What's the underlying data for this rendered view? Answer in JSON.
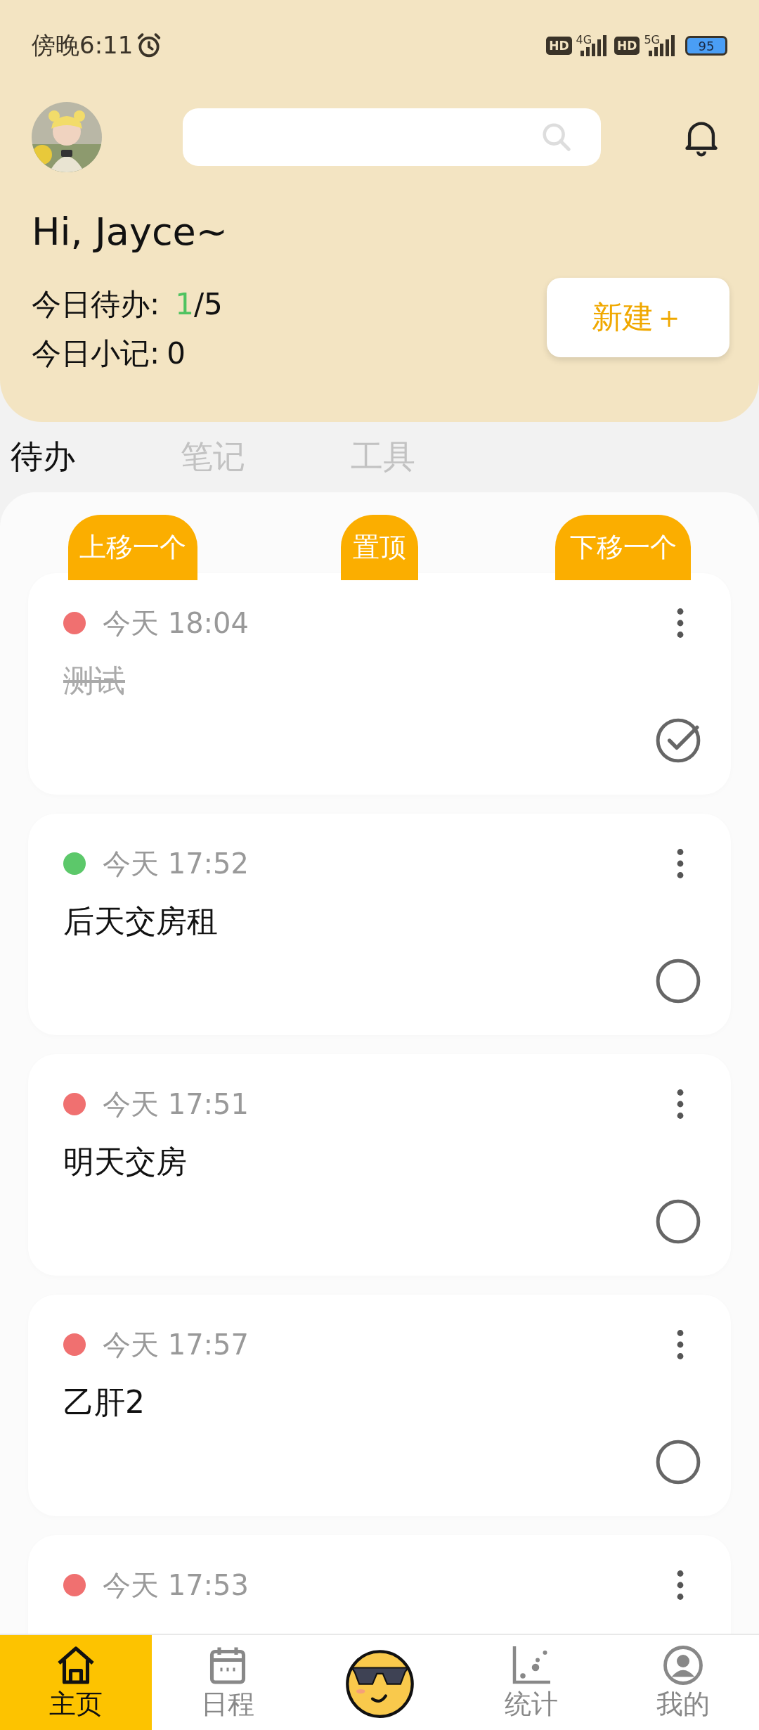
{
  "status_bar": {
    "time": "傍晚6:11",
    "networks": [
      {
        "badge": "HD",
        "type": "4G"
      },
      {
        "badge": "HD",
        "type": "5G"
      }
    ],
    "battery": "95"
  },
  "header": {
    "greeting": "Hi, Jayce~",
    "stats": [
      {
        "label": "今日待办:",
        "done": "1",
        "total": "/5"
      },
      {
        "label": "今日小记:",
        "value": "0"
      }
    ],
    "new_button": "新建＋"
  },
  "tabs": [
    {
      "label": "待办",
      "selected": true
    },
    {
      "label": "笔记",
      "selected": false
    },
    {
      "label": "工具",
      "selected": false
    }
  ],
  "actions": [
    "上移一个",
    "置顶",
    "下移一个"
  ],
  "todos": [
    {
      "color": "#f07070",
      "time": "今天 18:04",
      "title": "测试",
      "done": true
    },
    {
      "color": "#5cc86a",
      "time": "今天 17:52",
      "title": "后天交房租",
      "done": false
    },
    {
      "color": "#f07070",
      "time": "今天 17:51",
      "title": "明天交房",
      "done": false
    },
    {
      "color": "#f07070",
      "time": "今天 17:57",
      "title": "乙肝2",
      "done": false
    },
    {
      "color": "#f07070",
      "time": "今天 17:53"
    }
  ],
  "nav": [
    {
      "kind": "tab",
      "label": "主页",
      "selected": true
    },
    {
      "kind": "tab",
      "label": "日程",
      "selected": false
    },
    {
      "kind": "center"
    },
    {
      "kind": "tab",
      "label": "统计",
      "selected": false
    },
    {
      "kind": "tab",
      "label": "我的",
      "selected": false
    }
  ]
}
